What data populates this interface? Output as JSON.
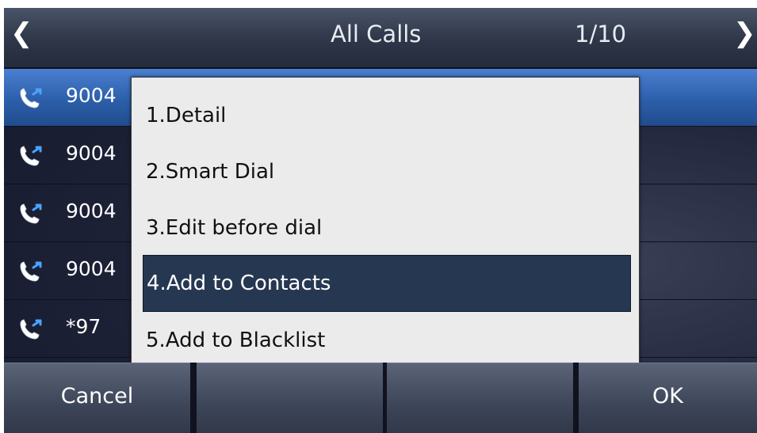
{
  "header": {
    "title": "All Calls",
    "page": "1/10",
    "prev_icon": "chevron-left-icon",
    "next_icon": "chevron-right-icon"
  },
  "calls": [
    {
      "number": "9004",
      "icon": "outgoing-call-icon"
    },
    {
      "number": "9004",
      "icon": "outgoing-call-icon"
    },
    {
      "number": "9004",
      "icon": "outgoing-call-icon"
    },
    {
      "number": "9004",
      "icon": "outgoing-call-icon"
    },
    {
      "number": "*97",
      "icon": "outgoing-call-icon"
    }
  ],
  "menu": {
    "items": [
      {
        "label": "1.Detail"
      },
      {
        "label": "2.Smart Dial"
      },
      {
        "label": "3.Edit before dial"
      },
      {
        "label": "4.Add to Contacts"
      },
      {
        "label": "5.Add to Blacklist"
      }
    ],
    "selected_index": 3
  },
  "softkeys": {
    "key1": "Cancel",
    "key2": "",
    "key3": "",
    "key4": "OK"
  },
  "colors": {
    "selected_row": "#2c5faa",
    "menu_selected": "#263752",
    "icon_blue": "#4aa3ff"
  }
}
